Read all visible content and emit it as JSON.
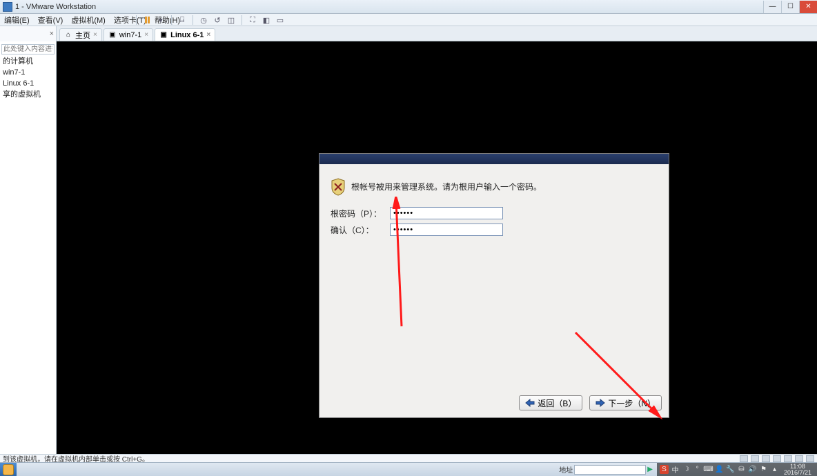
{
  "window": {
    "title": "1 - VMware Workstation"
  },
  "menu": {
    "edit": "编辑(E)",
    "view": "查看(V)",
    "vm": "虚拟机(M)",
    "tabs": "选项卡(T)",
    "help": "帮助(H)"
  },
  "sidebar": {
    "search_placeholder": "此处键入内容进行…",
    "nodes": {
      "mypc": "的计算机",
      "win71": "win7-1",
      "linux61": "Linux 6-1",
      "shared": "享的虚拟机"
    }
  },
  "tabs": {
    "home": "主页",
    "win71": "win7-1",
    "linux61": "Linux 6-1"
  },
  "installer": {
    "prompt": "根帐号被用来管理系统。请为根用户输入一个密码。",
    "root_pw_label": "根密码（P）：",
    "confirm_label": "确认（C）：",
    "root_pw_value": "••••••",
    "confirm_value": "••••••",
    "back_label": "返回（B）",
    "next_label": "下一步（N）"
  },
  "vm_status": {
    "hint": "到该虚拟机，请在虚拟机内部单击或按 Ctrl+G。"
  },
  "taskbar": {
    "address_label": "地址",
    "clock_time": "11:08",
    "clock_date": "2016/7/21",
    "tray_ime": "中"
  }
}
